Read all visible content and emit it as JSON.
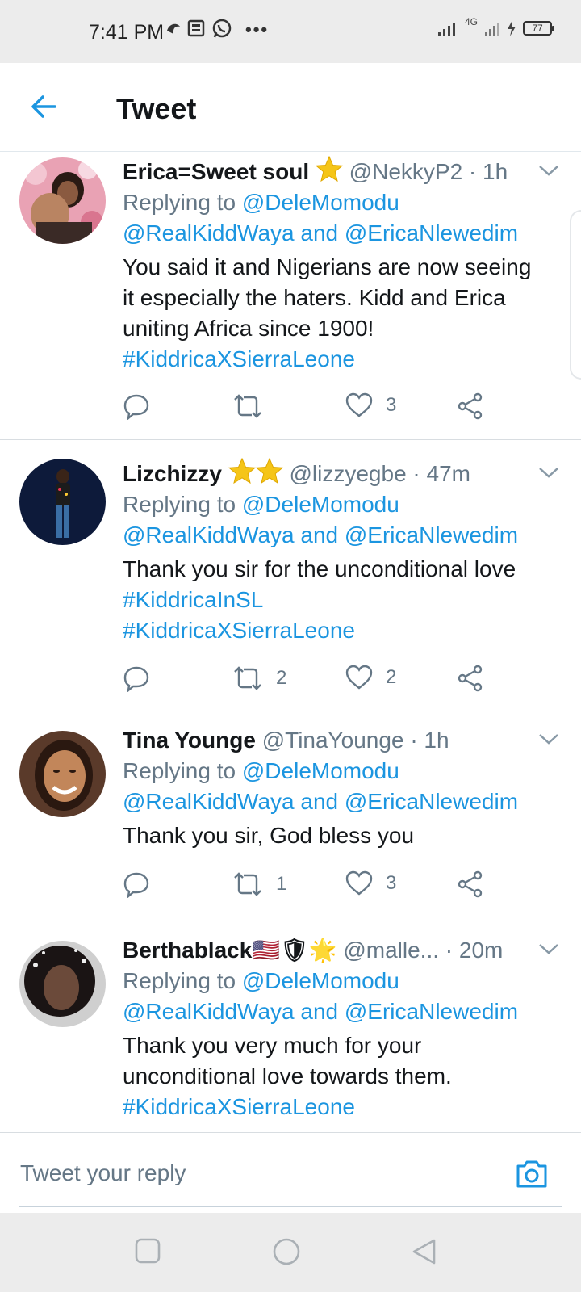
{
  "status_bar": {
    "time": "7:41 PM",
    "icons": [
      "vpn-icon",
      "news-icon",
      "whatsapp-icon"
    ],
    "overflow": "•••",
    "network": "4G",
    "battery": "77"
  },
  "header": {
    "title": "Tweet"
  },
  "tweets": [
    {
      "name": "Erica=Sweet soul",
      "stars": 1,
      "handle": "@NekkyP2",
      "time": "· 1h",
      "replying_prefix": "Replying to ",
      "replying_line1": "@DeleMomodu",
      "replying_line2a": "@RealKiddWaya",
      "replying_and": " and ",
      "replying_line2b": "@EricaNlewedim",
      "text_lines": [
        "You said it and Nigerians are now seeing",
        "it especially the haters. Kidd and Erica",
        "uniting Africa since 1900!"
      ],
      "hashtags": [
        "#KiddricaXSierraLeone"
      ],
      "retweets": "",
      "likes": "3",
      "avatar_colors": [
        "#e9a2b4",
        "#6d3a2c"
      ]
    },
    {
      "name": "Lizchizzy",
      "stars": 2,
      "handle": "@lizzyegbe",
      "time": "· 47m",
      "replying_prefix": "Replying to ",
      "replying_line1": "@DeleMomodu",
      "replying_line2a": "@RealKiddWaya",
      "replying_and": " and ",
      "replying_line2b": "@EricaNlewedim",
      "text_lines": [
        "Thank you sir for the unconditional love"
      ],
      "hashtags": [
        "#KiddricaInSL",
        "#KiddricaXSierraLeone"
      ],
      "retweets": "2",
      "likes": "2",
      "avatar_colors": [
        "#0d1a3a",
        "#2b2b2b"
      ]
    },
    {
      "name": "Tina Younge",
      "stars": 0,
      "handle": "@TinaYounge",
      "time": "· 1h",
      "replying_prefix": "Replying to ",
      "replying_line1": "@DeleMomodu",
      "replying_line2a": "@RealKiddWaya",
      "replying_and": " and ",
      "replying_line2b": "@EricaNlewedim",
      "text_lines": [
        "Thank you sir, God bless you"
      ],
      "hashtags": [],
      "retweets": "1",
      "likes": "3",
      "avatar_colors": [
        "#c2865a",
        "#3a2418"
      ]
    },
    {
      "name": "Berthablack🇺🇸🛡🌟",
      "stars": 0,
      "handle": "@malle...",
      "time": "· 20m",
      "replying_prefix": "Replying to ",
      "replying_line1": "@DeleMomodu",
      "replying_line2a": "@RealKiddWaya",
      "replying_and": " and ",
      "replying_line2b": "@EricaNlewedim",
      "text_lines": [
        "Thank you very much for your",
        "unconditional love towards them."
      ],
      "hashtags": [
        "#KiddricaXSierraLeone"
      ],
      "retweets": "",
      "likes": "",
      "avatar_colors": [
        "#1a1414",
        "#6b4a3a"
      ]
    }
  ],
  "composer": {
    "placeholder": "Tweet your reply"
  },
  "colors": {
    "accent": "#1b95e0",
    "muted": "#657786",
    "text": "#14171a",
    "star": "#f5c518"
  }
}
